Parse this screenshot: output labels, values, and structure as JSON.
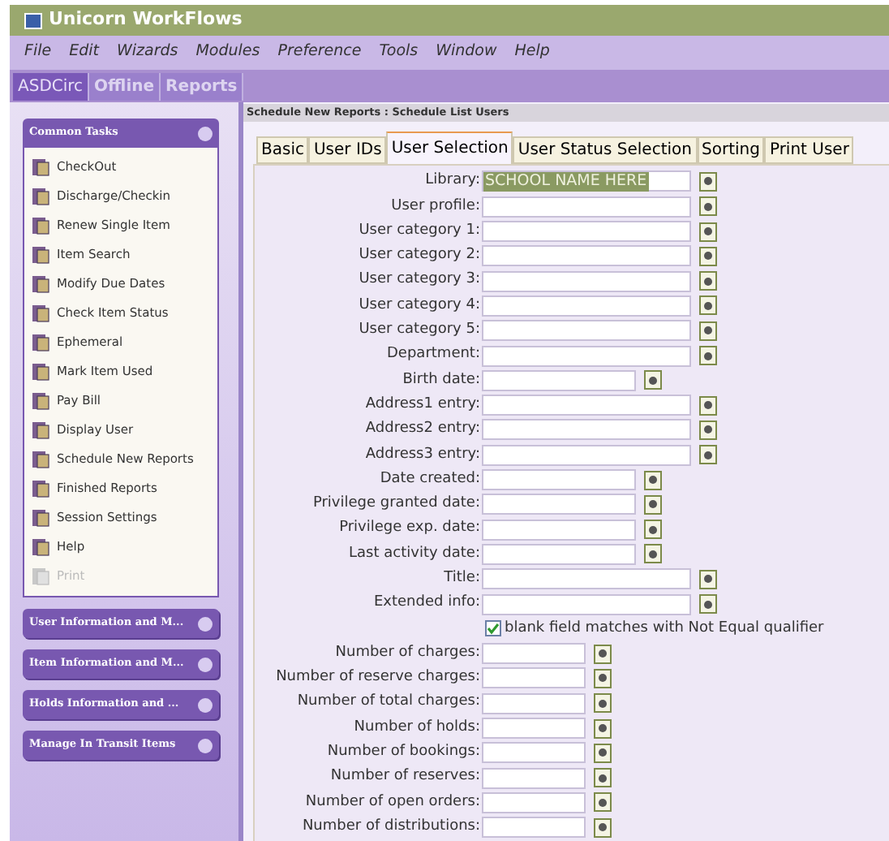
{
  "window": {
    "title": "Unicorn WorkFlows"
  },
  "menu": [
    "File",
    "Edit",
    "Wizards",
    "Modules",
    "Preference",
    "Tools",
    "Window",
    "Help"
  ],
  "modules": [
    {
      "label": "ASDCirc",
      "selected": true
    },
    {
      "label": "Offline",
      "selected": false
    },
    {
      "label": "Reports",
      "selected": false
    }
  ],
  "sidebar": {
    "sections": [
      {
        "title": "Common Tasks",
        "expanded": true,
        "items": [
          {
            "label": "CheckOut",
            "disabled": false
          },
          {
            "label": "Discharge/Checkin",
            "disabled": false
          },
          {
            "label": "Renew Single Item",
            "disabled": false
          },
          {
            "label": "Item Search",
            "disabled": false
          },
          {
            "label": "Modify Due Dates",
            "disabled": false
          },
          {
            "label": "Check Item Status",
            "disabled": false
          },
          {
            "label": "Ephemeral",
            "disabled": false
          },
          {
            "label": "Mark Item Used",
            "disabled": false
          },
          {
            "label": "Pay Bill",
            "disabled": false
          },
          {
            "label": "Display User",
            "disabled": false
          },
          {
            "label": "Schedule New Reports",
            "disabled": false
          },
          {
            "label": "Finished Reports",
            "disabled": false
          },
          {
            "label": "Session Settings",
            "disabled": false
          },
          {
            "label": "Help",
            "disabled": false
          },
          {
            "label": "Print",
            "disabled": true
          }
        ]
      },
      {
        "title": "User Information and M...",
        "expanded": false
      },
      {
        "title": "Item Information and M...",
        "expanded": false
      },
      {
        "title": "Holds Information and ...",
        "expanded": false
      },
      {
        "title": "Manage In Transit Items",
        "expanded": false
      }
    ]
  },
  "breadcrumb": "Schedule New Reports : Schedule List Users",
  "tabs": [
    {
      "label": "Basic",
      "selected": false
    },
    {
      "label": "User IDs",
      "selected": false
    },
    {
      "label": "User Selection",
      "selected": true
    },
    {
      "label": "User Status Selection",
      "selected": false
    },
    {
      "label": "Sorting",
      "selected": false
    },
    {
      "label": "Print User",
      "selected": false
    }
  ],
  "form": [
    {
      "kind": "text",
      "label": "Library:",
      "value": "SCHOOL NAME HERE"
    },
    {
      "kind": "text",
      "label": "User profile:"
    },
    {
      "kind": "text",
      "label": "User category 1:"
    },
    {
      "kind": "text",
      "label": "User category 2:"
    },
    {
      "kind": "text",
      "label": "User category 3:"
    },
    {
      "kind": "text",
      "label": "User category 4:"
    },
    {
      "kind": "text",
      "label": "User category 5:"
    },
    {
      "kind": "text",
      "label": "Department:"
    },
    {
      "kind": "date",
      "label": "Birth date:"
    },
    {
      "kind": "text",
      "label": "Address1 entry:"
    },
    {
      "kind": "text",
      "label": "Address2 entry:"
    },
    {
      "kind": "text",
      "label": "Address3 entry:"
    },
    {
      "kind": "date",
      "label": "Date created:"
    },
    {
      "kind": "date",
      "label": "Privilege granted date:"
    },
    {
      "kind": "date",
      "label": "Privilege exp. date:"
    },
    {
      "kind": "date",
      "label": "Last activity date:"
    },
    {
      "kind": "text",
      "label": "Title:"
    },
    {
      "kind": "text",
      "label": "Extended info:"
    },
    {
      "kind": "checkbox",
      "label": "blank field matches with Not Equal qualifier",
      "checked": true
    },
    {
      "kind": "number",
      "label": "Number of charges:"
    },
    {
      "kind": "number",
      "label": "Number of reserve charges:"
    },
    {
      "kind": "number",
      "label": "Number of total charges:"
    },
    {
      "kind": "number",
      "label": "Number of holds:"
    },
    {
      "kind": "number",
      "label": "Number of bookings:"
    },
    {
      "kind": "number",
      "label": "Number of reserves:"
    },
    {
      "kind": "number",
      "label": "Number of open orders:"
    },
    {
      "kind": "number",
      "label": "Number of distributions:"
    }
  ]
}
